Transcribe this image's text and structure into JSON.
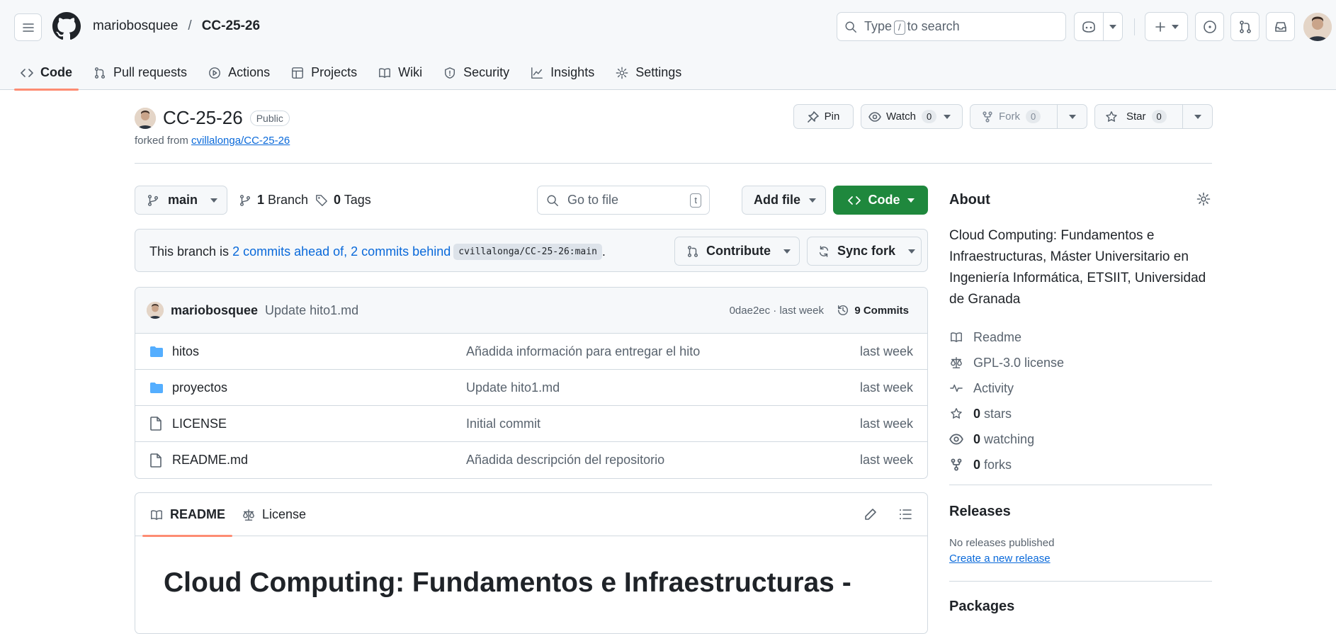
{
  "header": {
    "owner": "mariobosquee",
    "separator": "/",
    "repo": "CC-25-26",
    "search": {
      "prefix": "Type",
      "key": "/",
      "suffix": "to search"
    }
  },
  "nav": {
    "tabs": [
      {
        "label": "Code",
        "icon": "code-icon",
        "active": true
      },
      {
        "label": "Pull requests",
        "icon": "git-pull-request-icon"
      },
      {
        "label": "Actions",
        "icon": "play-icon"
      },
      {
        "label": "Projects",
        "icon": "table-icon"
      },
      {
        "label": "Wiki",
        "icon": "book-icon"
      },
      {
        "label": "Security",
        "icon": "shield-icon"
      },
      {
        "label": "Insights",
        "icon": "graph-icon"
      },
      {
        "label": "Settings",
        "icon": "gear-icon"
      }
    ]
  },
  "repo": {
    "title": "CC-25-26",
    "visibility": "Public",
    "forked_from_label": "forked from",
    "forked_from": "cvillalonga/CC-25-26",
    "pin": "Pin",
    "watch": "Watch",
    "watch_count": "0",
    "fork": "Fork",
    "fork_count": "0",
    "star": "Star",
    "star_count": "0"
  },
  "filebar": {
    "branch": "main",
    "branches_count": "1",
    "branches_label": "Branch",
    "tags_count": "0",
    "tags_label": "Tags",
    "goto_placeholder": "Go to file",
    "goto_key": "t",
    "add_file": "Add file",
    "code": "Code"
  },
  "branch_status": {
    "prefix": "This branch is",
    "ahead": "2 commits ahead of,",
    "behind": "2 commits behind",
    "upstream": "cvillalonga/CC-25-26:main",
    "suffix": ".",
    "contribute": "Contribute",
    "sync": "Sync fork"
  },
  "last_commit": {
    "author": "mariobosquee",
    "message": "Update hito1.md",
    "meta": "0dae2ec · last week",
    "commits": "9 Commits"
  },
  "files": [
    {
      "name": "hitos",
      "type": "folder",
      "message": "Añadida información para entregar el hito",
      "date": "last week"
    },
    {
      "name": "proyectos",
      "type": "folder",
      "message": "Update hito1.md",
      "date": "last week"
    },
    {
      "name": "LICENSE",
      "type": "file",
      "message": "Initial commit",
      "date": "last week"
    },
    {
      "name": "README.md",
      "type": "file",
      "message": "Añadida descripción del repositorio",
      "date": "last week"
    }
  ],
  "readme": {
    "tab_readme": "README",
    "tab_license": "License",
    "heading": "Cloud Computing: Fundamentos e Infraestructuras -"
  },
  "about": {
    "title": "About",
    "description": "Cloud Computing: Fundamentos e Infraestructuras, Máster Universitario en Ingeniería Informática, ETSIIT, Universidad de Granada",
    "readme": "Readme",
    "license": "GPL-3.0 license",
    "activity": "Activity",
    "stars_count": "0",
    "stars_label": "stars",
    "watching_count": "0",
    "watching_label": "watching",
    "forks_count": "0",
    "forks_label": "forks"
  },
  "releases": {
    "title": "Releases",
    "none": "No releases published",
    "create": "Create a new release"
  },
  "packages": {
    "title": "Packages"
  },
  "colors": {
    "accent": "#fd8c73",
    "link": "#0969da",
    "primary_button": "#1f883d",
    "folder": "#54aeff"
  }
}
